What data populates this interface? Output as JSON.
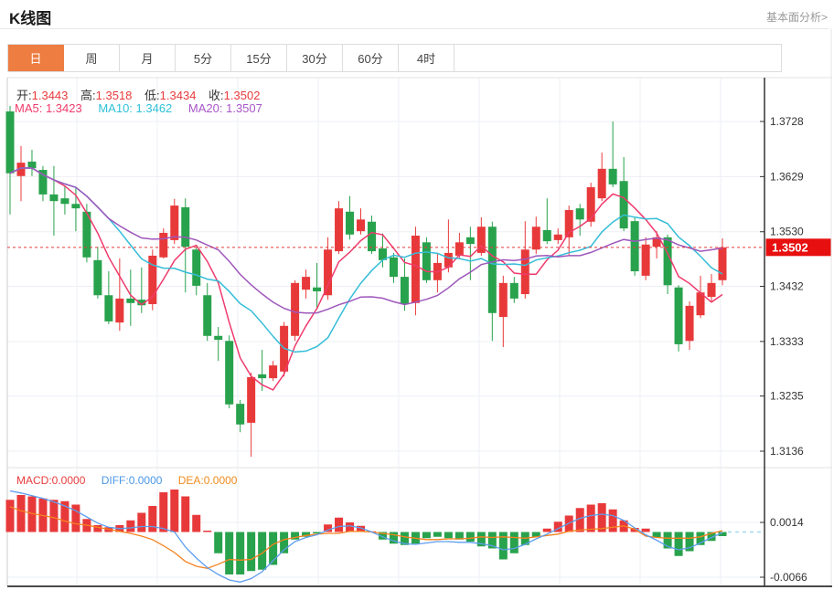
{
  "header": {
    "title": "K线图",
    "link": "基本面分析>"
  },
  "tabs": {
    "items": [
      {
        "label": "日",
        "selected": true
      },
      {
        "label": "周",
        "selected": false
      },
      {
        "label": "月",
        "selected": false
      },
      {
        "label": "5分",
        "selected": false
      },
      {
        "label": "15分",
        "selected": false
      },
      {
        "label": "30分",
        "selected": false
      },
      {
        "label": "60分",
        "selected": false
      },
      {
        "label": "4时",
        "selected": false
      }
    ]
  },
  "readout": {
    "open_label": "开:",
    "open": "1.3443",
    "high_label": "高:",
    "high": "1.3518",
    "low_label": "低:",
    "low": "1.3434",
    "close_label": "收:",
    "close": "1.3502",
    "ma5": "MA5: 1.3423",
    "ma10": "MA10: 1.3462",
    "ma20": "MA20: 1.3507",
    "macd": "MACD:0.0000",
    "diff": "DIFF:0.0000",
    "dea": "DEA:0.0000"
  },
  "colors": {
    "up": "#e8393a",
    "down": "#28a24c",
    "ma5": "#ef3a6d",
    "ma10": "#36bdd8",
    "ma20": "#9e57bb",
    "diff_line": "#5c9ded",
    "dea_line": "#f5821f",
    "accent_tab": "#ed7d41",
    "price_tag_bg": "#e70f0f",
    "dotted_price_line": "#e8393a",
    "zero_dash_line": "#a6d7f3",
    "axis_line": "#333333",
    "grid_line": "#edeff4"
  },
  "chart_data": {
    "type": "candlestick+macd",
    "title": "K线图",
    "price_axis": {
      "ticks": [
        {
          "label": "1.3728",
          "value": 1.3728
        },
        {
          "label": "1.3629",
          "value": 1.3629
        },
        {
          "label": "1.3530",
          "value": 1.353
        },
        {
          "label": "1.3432",
          "value": 1.3432
        },
        {
          "label": "1.3333",
          "value": 1.3333
        },
        {
          "label": "1.3235",
          "value": 1.3235
        },
        {
          "label": "1.3136",
          "value": 1.3136
        }
      ],
      "current_price": 1.3502,
      "current_price_label": "1.3502"
    },
    "macd_axis": {
      "ticks": [
        {
          "label": "0.0014",
          "value": 0.0014
        },
        {
          "label": "-0.0066",
          "value": -0.0066
        }
      ]
    },
    "ma_periods": [
      5,
      10,
      20
    ],
    "candles_ohlc_legend": "each candle = [open, high, low, close]; red=up green=down",
    "candles": [
      [
        1.3746,
        1.3756,
        1.3561,
        1.3635
      ],
      [
        1.363,
        1.3684,
        1.3585,
        1.3654
      ],
      [
        1.3656,
        1.3677,
        1.363,
        1.3644
      ],
      [
        1.3641,
        1.3648,
        1.3585,
        1.3597
      ],
      [
        1.3597,
        1.3648,
        1.3523,
        1.3585
      ],
      [
        1.359,
        1.3613,
        1.3561,
        1.358
      ],
      [
        1.358,
        1.361,
        1.3531,
        1.3572
      ],
      [
        1.3566,
        1.358,
        1.3475,
        1.3484
      ],
      [
        1.3479,
        1.3503,
        1.341,
        1.3416
      ],
      [
        1.3416,
        1.3459,
        1.3364,
        1.3369
      ],
      [
        1.3367,
        1.3482,
        1.3352,
        1.341
      ],
      [
        1.341,
        1.3462,
        1.3361,
        1.3402
      ],
      [
        1.3408,
        1.3466,
        1.3384,
        1.3398
      ],
      [
        1.34,
        1.3498,
        1.3389,
        1.3487
      ],
      [
        1.3484,
        1.3536,
        1.3482,
        1.3528
      ],
      [
        1.3515,
        1.3589,
        1.3508,
        1.3577
      ],
      [
        1.3574,
        1.359,
        1.3421,
        1.3503
      ],
      [
        1.3498,
        1.3503,
        1.3416,
        1.3433
      ],
      [
        1.3416,
        1.3438,
        1.3334,
        1.3343
      ],
      [
        1.3343,
        1.3359,
        1.3298,
        1.3336
      ],
      [
        1.3334,
        1.3344,
        1.3213,
        1.322
      ],
      [
        1.3221,
        1.3228,
        1.317,
        1.3184
      ],
      [
        1.3187,
        1.3277,
        1.3126,
        1.3269
      ],
      [
        1.3274,
        1.3318,
        1.3244,
        1.3267
      ],
      [
        1.3267,
        1.3298,
        1.3262,
        1.329
      ],
      [
        1.3279,
        1.3368,
        1.327,
        1.3361
      ],
      [
        1.3343,
        1.3443,
        1.3334,
        1.3438
      ],
      [
        1.3426,
        1.3462,
        1.341,
        1.3449
      ],
      [
        1.343,
        1.3474,
        1.3394,
        1.3423
      ],
      [
        1.3416,
        1.352,
        1.3408,
        1.3498
      ],
      [
        1.3495,
        1.3585,
        1.349,
        1.3572
      ],
      [
        1.3566,
        1.3594,
        1.3516,
        1.3525
      ],
      [
        1.3531,
        1.3572,
        1.3525,
        1.3552
      ],
      [
        1.3548,
        1.3559,
        1.349,
        1.3495
      ],
      [
        1.35,
        1.3527,
        1.3466,
        1.3479
      ],
      [
        1.3484,
        1.3492,
        1.3438,
        1.3449
      ],
      [
        1.3449,
        1.3482,
        1.3388,
        1.34
      ],
      [
        1.3402,
        1.3539,
        1.338,
        1.3523
      ],
      [
        1.3511,
        1.352,
        1.3438,
        1.3443
      ],
      [
        1.3443,
        1.349,
        1.3421,
        1.3474
      ],
      [
        1.3466,
        1.3552,
        1.3457,
        1.3492
      ],
      [
        1.3487,
        1.3528,
        1.3482,
        1.3511
      ],
      [
        1.352,
        1.3539,
        1.3443,
        1.3508
      ],
      [
        1.3492,
        1.3556,
        1.3487,
        1.3539
      ],
      [
        1.3539,
        1.3548,
        1.3334,
        1.3384
      ],
      [
        1.3377,
        1.3451,
        1.3323,
        1.3438
      ],
      [
        1.3438,
        1.3449,
        1.3402,
        1.341
      ],
      [
        1.3418,
        1.3549,
        1.341,
        1.3498
      ],
      [
        1.3498,
        1.3557,
        1.349,
        1.3539
      ],
      [
        1.3533,
        1.359,
        1.3508,
        1.3513
      ],
      [
        1.3515,
        1.3536,
        1.3508,
        1.3525
      ],
      [
        1.352,
        1.3577,
        1.3487,
        1.3569
      ],
      [
        1.3572,
        1.358,
        1.3523,
        1.3552
      ],
      [
        1.3548,
        1.3618,
        1.3539,
        1.361
      ],
      [
        1.359,
        1.3672,
        1.3585,
        1.3643
      ],
      [
        1.3643,
        1.3728,
        1.361,
        1.3615
      ],
      [
        1.3621,
        1.3664,
        1.3531,
        1.3536
      ],
      [
        1.3549,
        1.3556,
        1.3451,
        1.3459
      ],
      [
        1.3451,
        1.352,
        1.3443,
        1.3507
      ],
      [
        1.3503,
        1.3531,
        1.3482,
        1.352
      ],
      [
        1.352,
        1.3525,
        1.3418,
        1.3434
      ],
      [
        1.343,
        1.3434,
        1.3315,
        1.3328
      ],
      [
        1.3334,
        1.3405,
        1.3318,
        1.3397
      ],
      [
        1.338,
        1.3451,
        1.3375,
        1.3421
      ],
      [
        1.3413,
        1.3454,
        1.3405,
        1.3438
      ],
      [
        1.3443,
        1.3518,
        1.3434,
        1.3502
      ]
    ],
    "macd": {
      "bars": [
        0.0047,
        0.0054,
        0.0052,
        0.0049,
        0.0047,
        0.0045,
        0.004,
        0.0019,
        0.001,
        0.0007,
        0.001,
        0.0017,
        0.0028,
        0.0038,
        0.0058,
        0.0062,
        0.0052,
        0.0025,
        0.0002,
        -0.0031,
        -0.0062,
        -0.0062,
        -0.0057,
        -0.0055,
        -0.0048,
        -0.0031,
        -0.0011,
        -0.0007,
        -0.0002,
        0.0011,
        0.0021,
        0.0014,
        0.0009,
        0.0001,
        -0.0011,
        -0.0017,
        -0.0019,
        -0.0017,
        -0.0009,
        -0.0007,
        -0.0009,
        -0.0011,
        -0.0014,
        -0.0021,
        -0.0024,
        -0.004,
        -0.0031,
        -0.0019,
        -0.0007,
        0.0005,
        0.0015,
        0.0024,
        0.0035,
        0.004,
        0.0042,
        0.0033,
        0.0017,
        0.0006,
        0.0005,
        -0.0008,
        -0.0024,
        -0.0035,
        -0.0028,
        -0.0019,
        -0.0013,
        -0.0006
      ],
      "diff": [
        0.006,
        0.0057,
        0.0053,
        0.0049,
        0.0044,
        0.0038,
        0.0031,
        0.0022,
        0.0013,
        0.0007,
        0.0005,
        0.0006,
        0.0008,
        0.0008,
        0.0005,
        0.0,
        -0.0022,
        -0.0038,
        -0.0052,
        -0.0062,
        -0.007,
        -0.0073,
        -0.0068,
        -0.0058,
        -0.0042,
        -0.0026,
        -0.0014,
        -0.0008,
        -0.0004,
        0.0003,
        0.0008,
        0.0009,
        0.0006,
        0.0,
        -0.0007,
        -0.0013,
        -0.0017,
        -0.0018,
        -0.0016,
        -0.0014,
        -0.0014,
        -0.0015,
        -0.0015,
        -0.0017,
        -0.002,
        -0.0026,
        -0.0024,
        -0.0018,
        -0.001,
        -0.0003,
        0.0005,
        0.0013,
        0.002,
        0.0024,
        0.0026,
        0.0024,
        0.0017,
        0.0006,
        -0.0004,
        -0.0012,
        -0.0021,
        -0.0026,
        -0.0023,
        -0.0016,
        -0.0008,
        -0.0001
      ],
      "dea": [
        0.0037,
        0.0031,
        0.0027,
        0.0024,
        0.0021,
        0.0016,
        0.0012,
        0.001,
        0.0007,
        0.0004,
        0.0001,
        -0.0002,
        -0.0006,
        -0.0011,
        -0.002,
        -0.003,
        -0.0043,
        -0.005,
        -0.0053,
        -0.0047,
        -0.004,
        -0.0041,
        -0.004,
        -0.0031,
        -0.0018,
        -0.0011,
        -0.0008,
        -0.0005,
        -0.0003,
        -0.0002,
        -0.0002,
        0.0001,
        0.0001,
        0.0,
        -0.0002,
        -0.0004,
        -0.0007,
        -0.0009,
        -0.0011,
        -0.0011,
        -0.001,
        -0.001,
        -0.0009,
        -0.0007,
        -0.0008,
        -0.0007,
        -0.0008,
        -0.0009,
        -0.0007,
        -0.0005,
        -0.0003,
        0.0001,
        0.0003,
        0.0004,
        0.0005,
        0.0007,
        0.0009,
        0.0004,
        -0.0006,
        -0.0008,
        -0.0009,
        -0.0009,
        -0.0009,
        -0.0007,
        -0.0002,
        0.0002
      ]
    }
  }
}
